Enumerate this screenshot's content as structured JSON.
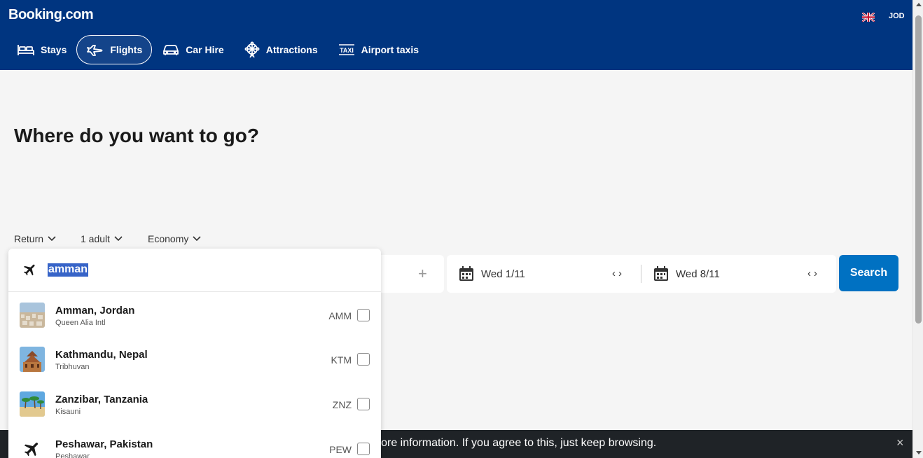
{
  "header": {
    "logo": "Booking.com",
    "currency": "JOD",
    "flag_icon": "uk-flag-icon"
  },
  "nav": {
    "items": [
      {
        "label": "Stays",
        "icon": "bed-icon",
        "active": false
      },
      {
        "label": "Flights",
        "icon": "plane-icon",
        "active": true
      },
      {
        "label": "Car Hire",
        "icon": "car-icon",
        "active": false
      },
      {
        "label": "Attractions",
        "icon": "ferris-wheel-icon",
        "active": false
      },
      {
        "label": "Airport taxis",
        "icon": "taxi-icon",
        "active": false
      }
    ]
  },
  "main": {
    "title": "Where do you want to go?",
    "options": {
      "trip_type": "Return",
      "passengers": "1 adult",
      "cabin_class": "Economy"
    },
    "search": {
      "from_value": "amman",
      "depart_date": "Wed 1/11",
      "return_date": "Wed 8/11",
      "search_label": "Search"
    }
  },
  "suggestions": [
    {
      "name": "Amman, Jordan",
      "airport": "Queen Alia Intl",
      "code": "AMM",
      "thumb": "photo"
    },
    {
      "name": "Kathmandu, Nepal",
      "airport": "Tribhuvan",
      "code": "KTM",
      "thumb": "photo"
    },
    {
      "name": "Zanzibar, Tanzania",
      "airport": "Kisauni",
      "code": "ZNZ",
      "thumb": "photo"
    },
    {
      "name": "Peshawar, Pakistan",
      "airport": "Peshawar",
      "code": "PEW",
      "thumb": "plane-icon"
    }
  ],
  "cookie_banner": {
    "text": "more information. If you agree to this, just keep browsing.",
    "close": "×"
  },
  "colors": {
    "brand_blue": "#003580",
    "search_button": "#0071c2",
    "selection": "#3764c8"
  }
}
